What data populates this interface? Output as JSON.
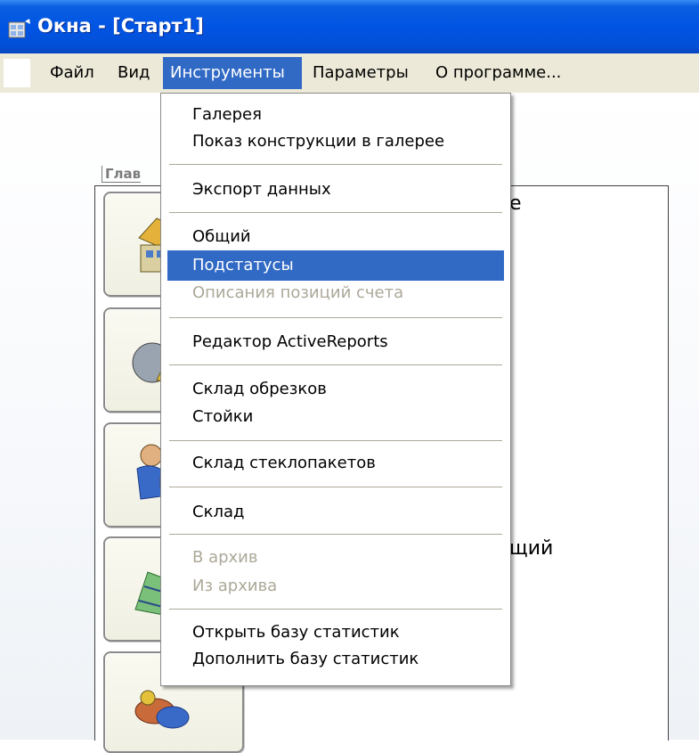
{
  "window": {
    "title": "Окна - [Старт1]",
    "colors": {
      "titlebar": "#0054e3",
      "menubar": "#ece9d8",
      "highlight": "#316ac5",
      "disabled": "#aca899"
    }
  },
  "menubar": {
    "items": [
      {
        "label": "Файл"
      },
      {
        "label": "Вид"
      },
      {
        "label": "Инструменты",
        "active": true
      },
      {
        "label": "Параметры"
      },
      {
        "label": "О программе..."
      }
    ]
  },
  "dropdown": {
    "items": [
      {
        "label": "Галерея"
      },
      {
        "label": "Показ конструкции в галерее"
      },
      {
        "label": "Экспорт данных"
      },
      {
        "label": "Общий"
      },
      {
        "label": "Подстатусы",
        "highlighted": true
      },
      {
        "label": "Описания позиций счета",
        "disabled": true
      },
      {
        "label": "Редактор ActiveReports"
      },
      {
        "label": "Склад обрезков"
      },
      {
        "label": "Стойки"
      },
      {
        "label": "Склад стеклопакетов"
      },
      {
        "label": "Склад"
      },
      {
        "label": "В архив",
        "disabled": true
      },
      {
        "label": "Из архива",
        "disabled": true
      },
      {
        "label": "Открыть базу статистик"
      },
      {
        "label": "Дополнить базу статистик"
      }
    ]
  },
  "background": {
    "panel_caption": "Глав",
    "text_fragment_1": "е",
    "text_fragment_2": "щий",
    "tile_icons": [
      "house-icon",
      "tools-icon",
      "worker-icon",
      "window-profile-icon",
      "parts-icon"
    ]
  }
}
